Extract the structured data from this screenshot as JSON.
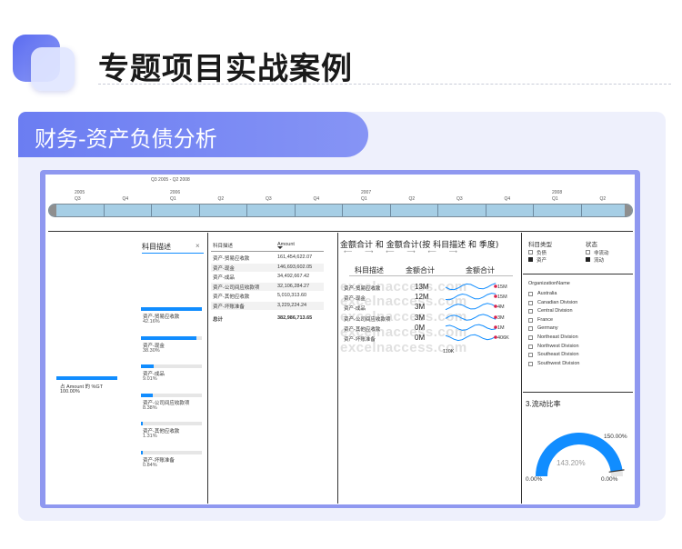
{
  "header": {
    "title": "专题项目实战案例"
  },
  "card": {
    "tab_label": "财务-资产负债分析"
  },
  "timeline": {
    "range_label": "Q3 2005 - Q2 2008",
    "years": [
      "2005",
      "2006",
      "2007",
      "2008"
    ],
    "quarters": [
      "Q3",
      "Q4",
      "Q1",
      "Q2",
      "Q3",
      "Q4",
      "Q1",
      "Q2",
      "Q3",
      "Q4",
      "Q1",
      "Q2"
    ]
  },
  "tree": {
    "root_label": "占 Amount 的 %GT",
    "root_value": "100.00%",
    "filter_label": "科目描述",
    "close": "×",
    "items": [
      {
        "label": "资产-贸易应收款",
        "pct": "42.16%",
        "value": 42.16
      },
      {
        "label": "资产-现金",
        "pct": "38.30%",
        "value": 38.3
      },
      {
        "label": "资产-成品",
        "pct": "9.01%",
        "value": 9.01
      },
      {
        "label": "资产-公司间应收款项",
        "pct": "8.38%",
        "value": 8.38
      },
      {
        "label": "资产-其他应收款",
        "pct": "1.31%",
        "value": 1.31
      },
      {
        "label": "资产-坏账准备",
        "pct": "0.84%",
        "value": 0.84
      }
    ]
  },
  "table": {
    "col1": "科目描述",
    "col2": "Amount",
    "rows": [
      {
        "name": "资产-贸易应收款",
        "amount": "161,454,622.07"
      },
      {
        "name": "资产-现金",
        "amount": "146,693,602.05"
      },
      {
        "name": "资产-成品",
        "amount": "34,492,667.42"
      },
      {
        "name": "资产-公司间应收款项",
        "amount": "32,106,284.27"
      },
      {
        "name": "资产-其他应收款",
        "amount": "5,010,313.60"
      },
      {
        "name": "资产-坏账准备",
        "amount": "3,229,224.24"
      }
    ],
    "total_label": "总计",
    "total_amount": "382,986,713.65"
  },
  "sparkline_panel": {
    "title": "金额合计 和 金额合计(按 科目描述 和 季度)",
    "col_name": "科目描述",
    "col_total": "金额合计",
    "col_trend": "金额合计",
    "rows": [
      {
        "name": "资产-贸易应收款",
        "total": "13M",
        "end": "15M"
      },
      {
        "name": "资产-现金",
        "total": "12M",
        "end": "15M"
      },
      {
        "name": "资产-成品",
        "total": "3M",
        "end": "4M"
      },
      {
        "name": "资产-公司间应收款项",
        "total": "3M",
        "end": "3M"
      },
      {
        "name": "资产-其他应收款",
        "total": "0M",
        "end": "1M"
      },
      {
        "name": "资产-坏账准备",
        "total": "0M",
        "end": "406K"
      }
    ],
    "min_label": "110K",
    "watermark": "excelnaccess.com"
  },
  "slicers": {
    "type_title": "科目类型",
    "type_items": [
      {
        "label": "负债",
        "on": false
      },
      {
        "label": "资产",
        "on": true
      }
    ],
    "status_title": "状态",
    "status_items": [
      {
        "label": "非流动",
        "on": false
      },
      {
        "label": "流动",
        "on": true
      }
    ],
    "org_title": "OrganizationName",
    "org_items": [
      "Australia",
      "Canadian Division",
      "Central Division",
      "France",
      "Germany",
      "Northeast Division",
      "Northwest Division",
      "Southeast Division",
      "Southwest Division"
    ]
  },
  "gauge": {
    "title": "3.流动比率",
    "value": 143.2,
    "value_label": "143.20%",
    "min_label": "0.00%",
    "max_label": "150.00%",
    "target_label": "0.00%",
    "min": 0,
    "max": 150,
    "color": "#118dff"
  }
}
